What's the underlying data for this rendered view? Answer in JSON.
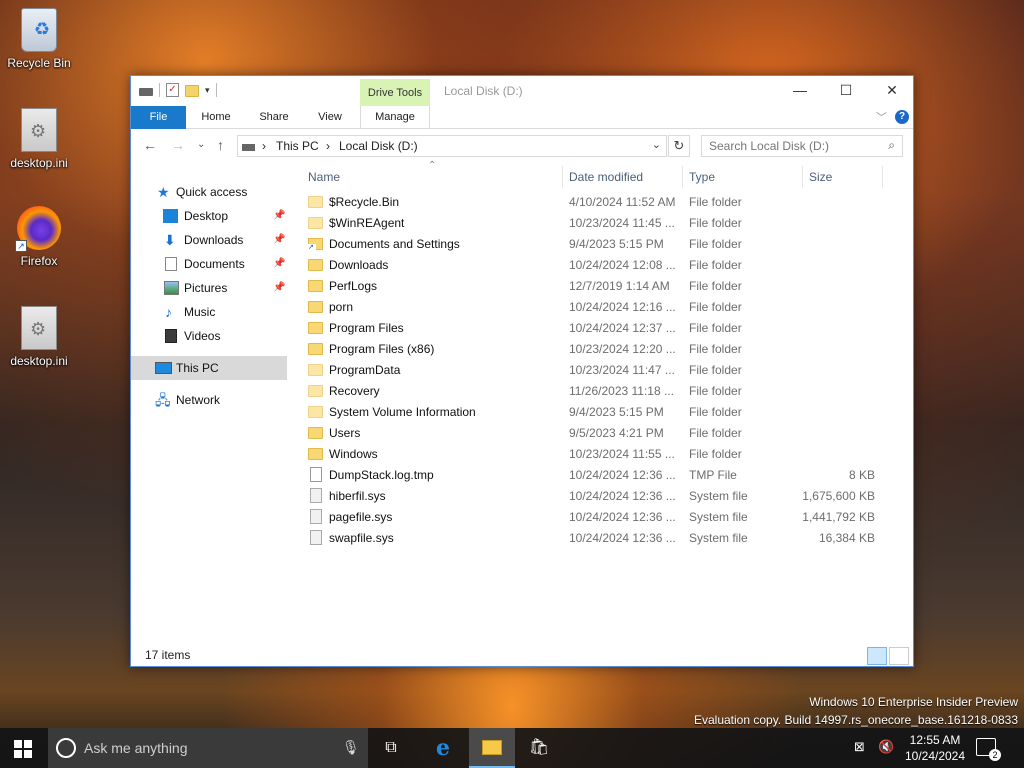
{
  "desktop": {
    "icons": [
      {
        "label": "Recycle Bin"
      },
      {
        "label": "desktop.ini"
      },
      {
        "label": "Firefox"
      },
      {
        "label": "desktop.ini"
      }
    ]
  },
  "window": {
    "title": "Local Disk (D:)",
    "contextual_tab_group": "Drive Tools",
    "tabs": [
      "File",
      "Home",
      "Share",
      "View",
      "Manage"
    ],
    "breadcrumb": [
      "This PC",
      "Local Disk (D:)"
    ],
    "search_placeholder": "Search Local Disk (D:)",
    "nav": {
      "quick_access": "Quick access",
      "items": [
        {
          "label": "Desktop",
          "pinned": true
        },
        {
          "label": "Downloads",
          "pinned": true
        },
        {
          "label": "Documents",
          "pinned": true
        },
        {
          "label": "Pictures",
          "pinned": true
        },
        {
          "label": "Music",
          "pinned": false
        },
        {
          "label": "Videos",
          "pinned": false
        }
      ],
      "this_pc": "This PC",
      "network": "Network"
    },
    "columns": {
      "name": "Name",
      "date": "Date modified",
      "type": "Type",
      "size": "Size"
    },
    "files": [
      {
        "name": "$Recycle.Bin",
        "date": "4/10/2024 11:52 AM",
        "type": "File folder",
        "size": "",
        "icon": "folder-faded"
      },
      {
        "name": "$WinREAgent",
        "date": "10/23/2024 11:45 ...",
        "type": "File folder",
        "size": "",
        "icon": "folder-faded"
      },
      {
        "name": "Documents and Settings",
        "date": "9/4/2023 5:15 PM",
        "type": "File folder",
        "size": "",
        "icon": "shortcut-folder"
      },
      {
        "name": "Downloads",
        "date": "10/24/2024 12:08 ...",
        "type": "File folder",
        "size": "",
        "icon": "folder"
      },
      {
        "name": "PerfLogs",
        "date": "12/7/2019 1:14 AM",
        "type": "File folder",
        "size": "",
        "icon": "folder"
      },
      {
        "name": "porn",
        "date": "10/24/2024 12:16 ...",
        "type": "File folder",
        "size": "",
        "icon": "folder"
      },
      {
        "name": "Program Files",
        "date": "10/24/2024 12:37 ...",
        "type": "File folder",
        "size": "",
        "icon": "folder"
      },
      {
        "name": "Program Files (x86)",
        "date": "10/23/2024 12:20 ...",
        "type": "File folder",
        "size": "",
        "icon": "folder"
      },
      {
        "name": "ProgramData",
        "date": "10/23/2024 11:47 ...",
        "type": "File folder",
        "size": "",
        "icon": "folder-faded"
      },
      {
        "name": "Recovery",
        "date": "11/26/2023 11:18 ...",
        "type": "File folder",
        "size": "",
        "icon": "folder-faded"
      },
      {
        "name": "System Volume Information",
        "date": "9/4/2023 5:15 PM",
        "type": "File folder",
        "size": "",
        "icon": "folder-faded"
      },
      {
        "name": "Users",
        "date": "9/5/2023 4:21 PM",
        "type": "File folder",
        "size": "",
        "icon": "folder"
      },
      {
        "name": "Windows",
        "date": "10/23/2024 11:55 ...",
        "type": "File folder",
        "size": "",
        "icon": "folder"
      },
      {
        "name": "DumpStack.log.tmp",
        "date": "10/24/2024 12:36 ...",
        "type": "TMP File",
        "size": "8 KB",
        "icon": "file"
      },
      {
        "name": "hiberfil.sys",
        "date": "10/24/2024 12:36 ...",
        "type": "System file",
        "size": "1,675,600 KB",
        "icon": "sysfile"
      },
      {
        "name": "pagefile.sys",
        "date": "10/24/2024 12:36 ...",
        "type": "System file",
        "size": "1,441,792 KB",
        "icon": "sysfile"
      },
      {
        "name": "swapfile.sys",
        "date": "10/24/2024 12:36 ...",
        "type": "System file",
        "size": "16,384 KB",
        "icon": "sysfile"
      }
    ],
    "status": "17 items"
  },
  "watermark": {
    "line1": "Windows 10 Enterprise Insider Preview",
    "line2": "Evaluation copy. Build 14997.rs_onecore_base.161218-0833"
  },
  "taskbar": {
    "search_placeholder": "Ask me anything",
    "time": "12:55 AM",
    "date": "10/24/2024",
    "notification_count": "2"
  },
  "colors": {
    "accent": "#1979ca",
    "drive_tools": "#d9f3b5",
    "folder": "#f8d775"
  }
}
